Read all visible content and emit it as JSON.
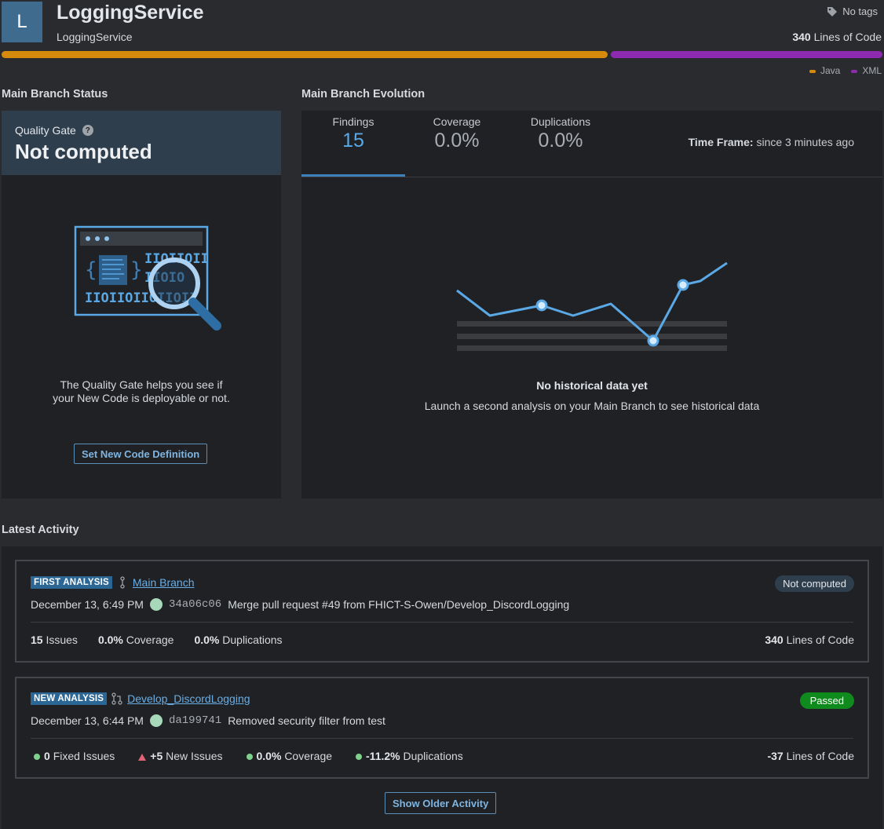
{
  "header": {
    "avatar_letter": "L",
    "title": "LoggingService",
    "key": "LoggingService",
    "tags_label": "No tags",
    "loc_value": "340",
    "loc_label": "Lines of Code",
    "languages": [
      {
        "name": "Java",
        "color": "#d68a0c"
      },
      {
        "name": "XML",
        "color": "#8e2ab0"
      }
    ]
  },
  "status_section": {
    "title": "Main Branch Status",
    "quality_gate_label": "Quality Gate",
    "help_glyph": "?",
    "quality_gate_status": "Not computed",
    "description_line1": "The Quality Gate helps you see if",
    "description_line2": "your New Code is deployable or not.",
    "button_label": "Set New Code Definition"
  },
  "evolution_section": {
    "title": "Main Branch Evolution",
    "tabs": [
      {
        "label": "Findings",
        "value": "15"
      },
      {
        "label": "Coverage",
        "value": "0.0%"
      },
      {
        "label": "Duplications",
        "value": "0.0%"
      }
    ],
    "timeframe_label": "Time Frame:",
    "timeframe_value": "since 3 minutes ago",
    "empty_title": "No historical data yet",
    "empty_subtitle": "Launch a second analysis on your Main Branch to see historical data"
  },
  "activity": {
    "title": "Latest Activity",
    "cards": [
      {
        "type_badge": "FIRST ANALYSIS",
        "branch_icon": "branch-icon",
        "branch": "Main Branch",
        "status": "Not computed",
        "date": "December 13, 6:49 PM",
        "hash": "34a06c06",
        "message": "Merge pull request #49 from FHICT-S-Owen/Develop_DiscordLogging",
        "m1_value": "15",
        "m1_label": "Issues",
        "m2_value": "0.0%",
        "m2_label": "Coverage",
        "m3_value": "0.0%",
        "m3_label": "Duplications",
        "loc_value": "340",
        "loc_label": "Lines of Code"
      },
      {
        "type_badge": "NEW ANALYSIS",
        "branch_icon": "pull-request-icon",
        "branch": "Develop_DiscordLogging",
        "status": "Passed",
        "date": "December 13, 6:44 PM",
        "hash": "da199741",
        "message": "Removed security filter from test",
        "m1_value": "0",
        "m1_label": "Fixed Issues",
        "m2_value": "+5",
        "m2_label": "New Issues",
        "m3_value": "0.0%",
        "m3_label": "Coverage",
        "m4_value": "-11.2%",
        "m4_label": "Duplications",
        "loc_value": "-37",
        "loc_label": "Lines of Code"
      }
    ],
    "older_button": "Show Older Activity"
  },
  "colors": {
    "accent": "#5aa9e6",
    "passed": "#0f8a1d",
    "not_computed_bg": "#2f3e4d"
  }
}
